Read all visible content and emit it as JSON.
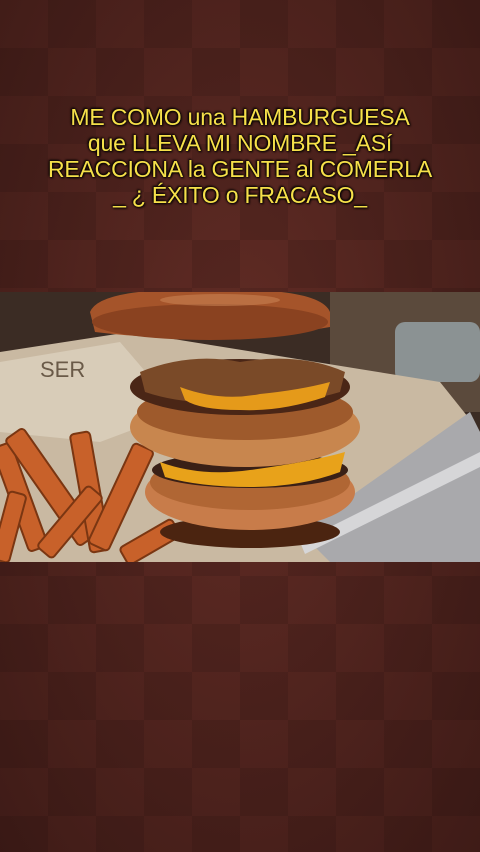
{
  "title": {
    "lines": [
      "ME COMO una HAMBURGUESA",
      "que LLEVA MI NOMBRE _ASí",
      "REACCIONA la GENTE al COMERLA",
      "_ ¿ ÉXITO o FRACASO_"
    ]
  },
  "media": {
    "subject": "burger-with-fries-photo"
  },
  "colors": {
    "title_text": "#f6e04a",
    "background": "#5a2a24"
  }
}
